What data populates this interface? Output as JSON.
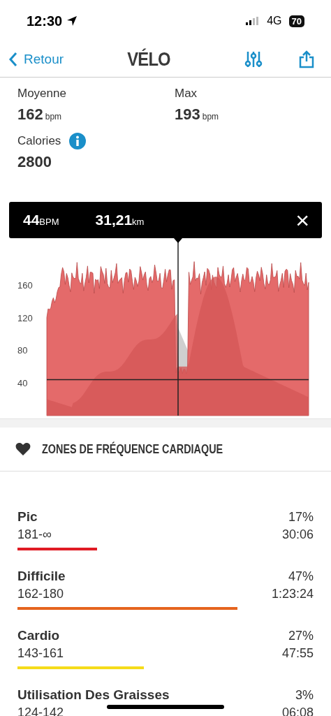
{
  "status_bar": {
    "time": "12:30",
    "network": "4G",
    "battery": "70"
  },
  "nav": {
    "back": "Retour",
    "title": "VÉLO"
  },
  "stats": [
    {
      "label": "Moyenne",
      "value": "162",
      "unit": "bpm"
    },
    {
      "label": "Max",
      "value": "193",
      "unit": "bpm"
    },
    {
      "label": "Calories",
      "value": "2800",
      "info": true
    }
  ],
  "tooltip": {
    "value": "44",
    "value_unit": "BPM",
    "distance": "31,21",
    "distance_unit": "km",
    "close": "×"
  },
  "chart": {
    "y_labels": [
      "160",
      "120",
      "80",
      "40"
    ]
  },
  "zones_header": "ZONES DE FRÉQUENCE CARDIAQUE",
  "zones": [
    {
      "name": "Pic",
      "range": "181-∞",
      "percent": "17%",
      "time": "30:06",
      "color": "#e01b24"
    },
    {
      "name": "Difficile",
      "range": "162-180",
      "percent": "47%",
      "time": "1:23:24",
      "color": "#e5641e"
    },
    {
      "name": "Cardio",
      "range": "143-161",
      "percent": "27%",
      "time": "47:55",
      "color": "#f5dc1a"
    },
    {
      "name": "Utilisation Des Graisses",
      "range": "124-142",
      "percent": "3%",
      "time": "06:08"
    }
  ]
}
